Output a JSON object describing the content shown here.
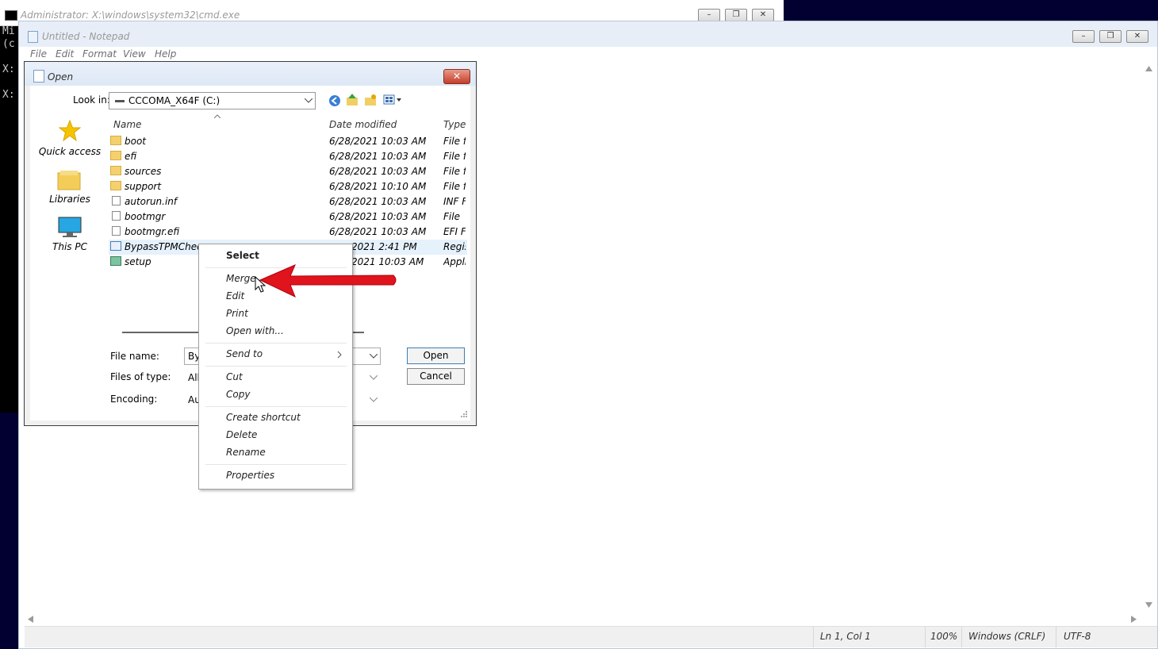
{
  "cmd": {
    "title": "Administrator: X:\\windows\\system32\\cmd.exe",
    "lines": [
      "Mi",
      "(c",
      "X:",
      "X:"
    ],
    "buttons": {
      "minimize": "–",
      "restore": "❐",
      "close": "✕"
    }
  },
  "notepad": {
    "title": "Untitled - Notepad",
    "menu": [
      "File",
      "Edit",
      "Format",
      "View",
      "Help"
    ],
    "buttons": {
      "minimize": "–",
      "restore": "❐",
      "close": "✕"
    },
    "status": {
      "position": "Ln 1, Col 1",
      "zoom": "100%",
      "line_ending": "Windows (CRLF)",
      "encoding": "UTF-8"
    }
  },
  "dialog": {
    "title": "Open",
    "close": "✕",
    "look_in_label": "Look in:",
    "look_in_value": "CCCOMA_X64F (C:)",
    "places": [
      "Quick access",
      "Libraries",
      "This PC"
    ],
    "columns": {
      "name": "Name",
      "date": "Date modified",
      "type": "Type"
    },
    "files": [
      {
        "name": "boot",
        "date": "6/28/2021 10:03 AM",
        "type": "File fc",
        "icon": "folder"
      },
      {
        "name": "efi",
        "date": "6/28/2021 10:03 AM",
        "type": "File fc",
        "icon": "folder"
      },
      {
        "name": "sources",
        "date": "6/28/2021 10:03 AM",
        "type": "File fc",
        "icon": "folder"
      },
      {
        "name": "support",
        "date": "6/28/2021 10:10 AM",
        "type": "File fc",
        "icon": "folder"
      },
      {
        "name": "autorun.inf",
        "date": "6/28/2021 10:03 AM",
        "type": "INF F",
        "icon": "file"
      },
      {
        "name": "bootmgr",
        "date": "6/28/2021 10:03 AM",
        "type": "File",
        "icon": "file"
      },
      {
        "name": "bootmgr.efi",
        "date": "6/28/2021 10:03 AM",
        "type": "EFI Fi",
        "icon": "file"
      },
      {
        "name": "BypassTPMChec",
        "date": "2021 2:41 PM",
        "type": "Regis",
        "icon": "registry"
      },
      {
        "name": "setup",
        "date": "2021 10:03 AM",
        "type": "Appli",
        "icon": "application"
      }
    ],
    "file_name_label": "File name:",
    "file_name_value": "By",
    "files_of_type_label": "Files of type:",
    "files_of_type_value": "All",
    "encoding_label": "Encoding:",
    "encoding_value": "Au",
    "open_button": "Open",
    "cancel_button": "Cancel"
  },
  "context_menu": {
    "items": [
      "Select",
      "Merge",
      "Edit",
      "Print",
      "Open with...",
      "Send to",
      "Cut",
      "Copy",
      "Create shortcut",
      "Delete",
      "Rename",
      "Properties"
    ]
  },
  "colors": {
    "arrow": "#e0141c",
    "selection": "#e5f1fb",
    "dialog_close": "#c53e2a"
  }
}
